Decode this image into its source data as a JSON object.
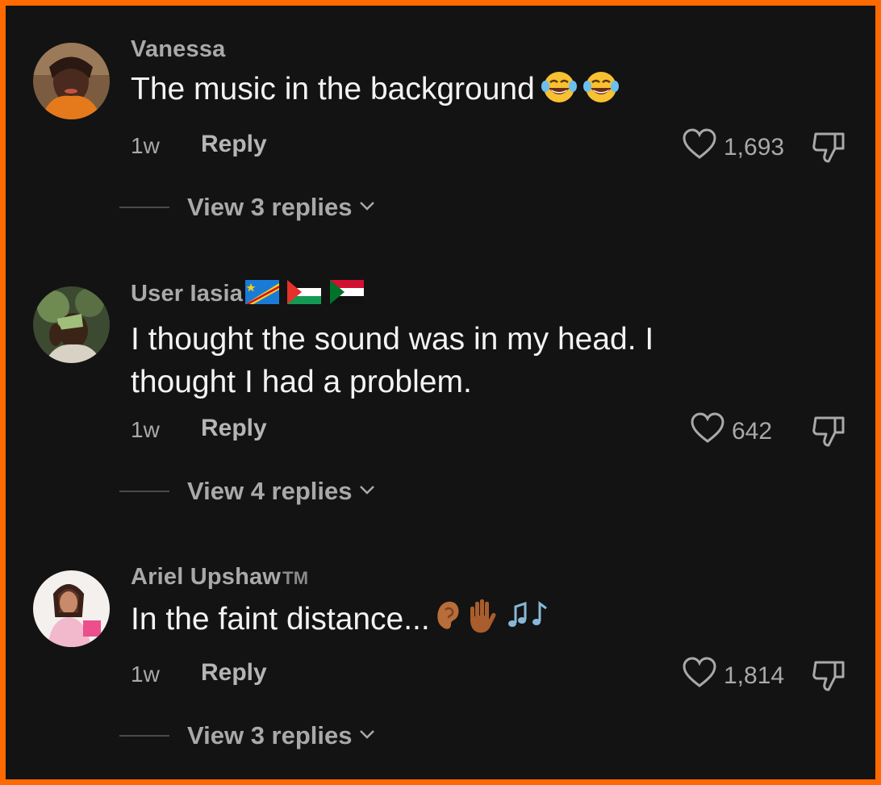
{
  "comments": [
    {
      "username": "Vanessa",
      "text": "The music in the background",
      "time": "1w",
      "reply_label": "Reply",
      "likes": "1,693",
      "view_replies": "View 3 replies"
    },
    {
      "username": "User Iasia",
      "text_line1": "I thought the sound was in my head. I",
      "text_line2": "thought I had a problem.",
      "time": "1w",
      "reply_label": "Reply",
      "likes": "642",
      "view_replies": "View 4 replies"
    },
    {
      "username": "Ariel Upshaw",
      "username_suffix": "TM",
      "text": "In the faint distance...",
      "time": "1w",
      "reply_label": "Reply",
      "likes": "1,814",
      "view_replies": "View 3 replies"
    }
  ],
  "icons": {
    "like": "heart-outline-icon",
    "dislike": "thumbs-down-outline-icon",
    "expand": "chevron-down-icon"
  },
  "colors": {
    "border": "#ff6a00",
    "background": "#131313",
    "text": "#f3f3f3",
    "muted": "#a9a9a9"
  }
}
